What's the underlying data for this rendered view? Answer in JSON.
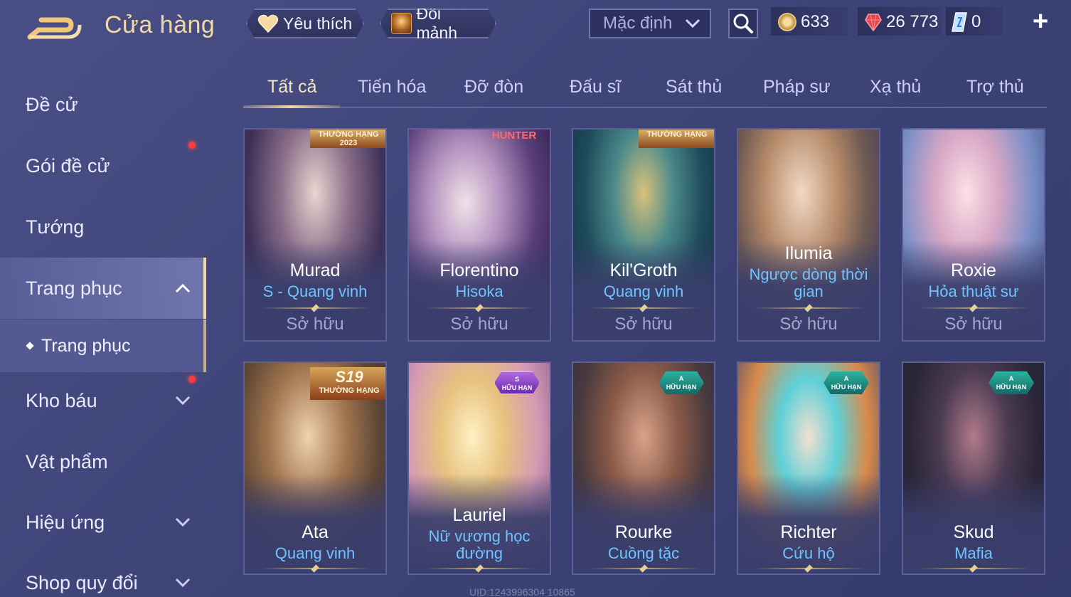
{
  "header": {
    "title": "Cửa hàng",
    "favorite_label": "Yêu thích",
    "exchange_label": "Đổi mảnh",
    "sort_value": "Mặc định",
    "currencies": {
      "gold": "633",
      "ruby": "26 773",
      "gem": "0"
    },
    "plus_label": "+"
  },
  "sidebar": {
    "items": [
      {
        "label": "Đề cử"
      },
      {
        "label": "Gói đề cử"
      },
      {
        "label": "Tướng"
      },
      {
        "label": "Trang phục"
      },
      {
        "label": "Kho báu"
      },
      {
        "label": "Vật phẩm"
      },
      {
        "label": "Hiệu ứng"
      },
      {
        "label": "Shop quy đổi"
      }
    ],
    "sub_item": "Trang phục"
  },
  "tabs": [
    "Tất cả",
    "Tiến hóa",
    "Đỡ đòn",
    "Đấu sĩ",
    "Sát thủ",
    "Pháp sư",
    "Xạ thủ",
    "Trợ thủ"
  ],
  "cards": [
    {
      "name": "Murad",
      "skin": "S - Quang vinh",
      "status": "Sở hữu",
      "badge": "THƯỜNG HẠNG 2023"
    },
    {
      "name": "Florentino",
      "skin": "Hisoka",
      "status": "Sở hữu",
      "badge": "HUNTER"
    },
    {
      "name": "Kil'Groth",
      "skin": "Quang vinh",
      "status": "Sở hữu",
      "badge": "THƯỜNG HẠNG"
    },
    {
      "name": "Ilumia",
      "skin": "Ngược dòng thời gian",
      "status": "Sở hữu",
      "badge": ""
    },
    {
      "name": "Roxie",
      "skin": "Hỏa thuật sư",
      "status": "Sở hữu",
      "badge": ""
    },
    {
      "name": "Ata",
      "skin": "Quang vinh",
      "status": "Sở hữu",
      "badge_big": "S19",
      "badge": "THƯỜNG HẠNG"
    },
    {
      "name": "Lauriel",
      "skin": "Nữ vương học đường",
      "status": "Sở hữu",
      "tier": "S",
      "tier_sub": "HỮU HẠN"
    },
    {
      "name": "Rourke",
      "skin": "Cuồng tặc",
      "status": "Sở hữu",
      "tier": "A",
      "tier_sub": "HỮU HẠN"
    },
    {
      "name": "Richter",
      "skin": "Cứu hộ",
      "status": "Sở hữu",
      "tier": "A",
      "tier_sub": "HỮU HẠN"
    },
    {
      "name": "Skud",
      "skin": "Mafia",
      "status": "Sở hữu",
      "tier": "A",
      "tier_sub": "HỮU HẠN"
    }
  ],
  "watermark": "UID:1243996304 10865",
  "colors": {
    "accent_gold": "#f1d9a4",
    "skin_blue": "#6fc4ff",
    "bg": "#3e4478",
    "notify_red": "#ff3b3b"
  }
}
